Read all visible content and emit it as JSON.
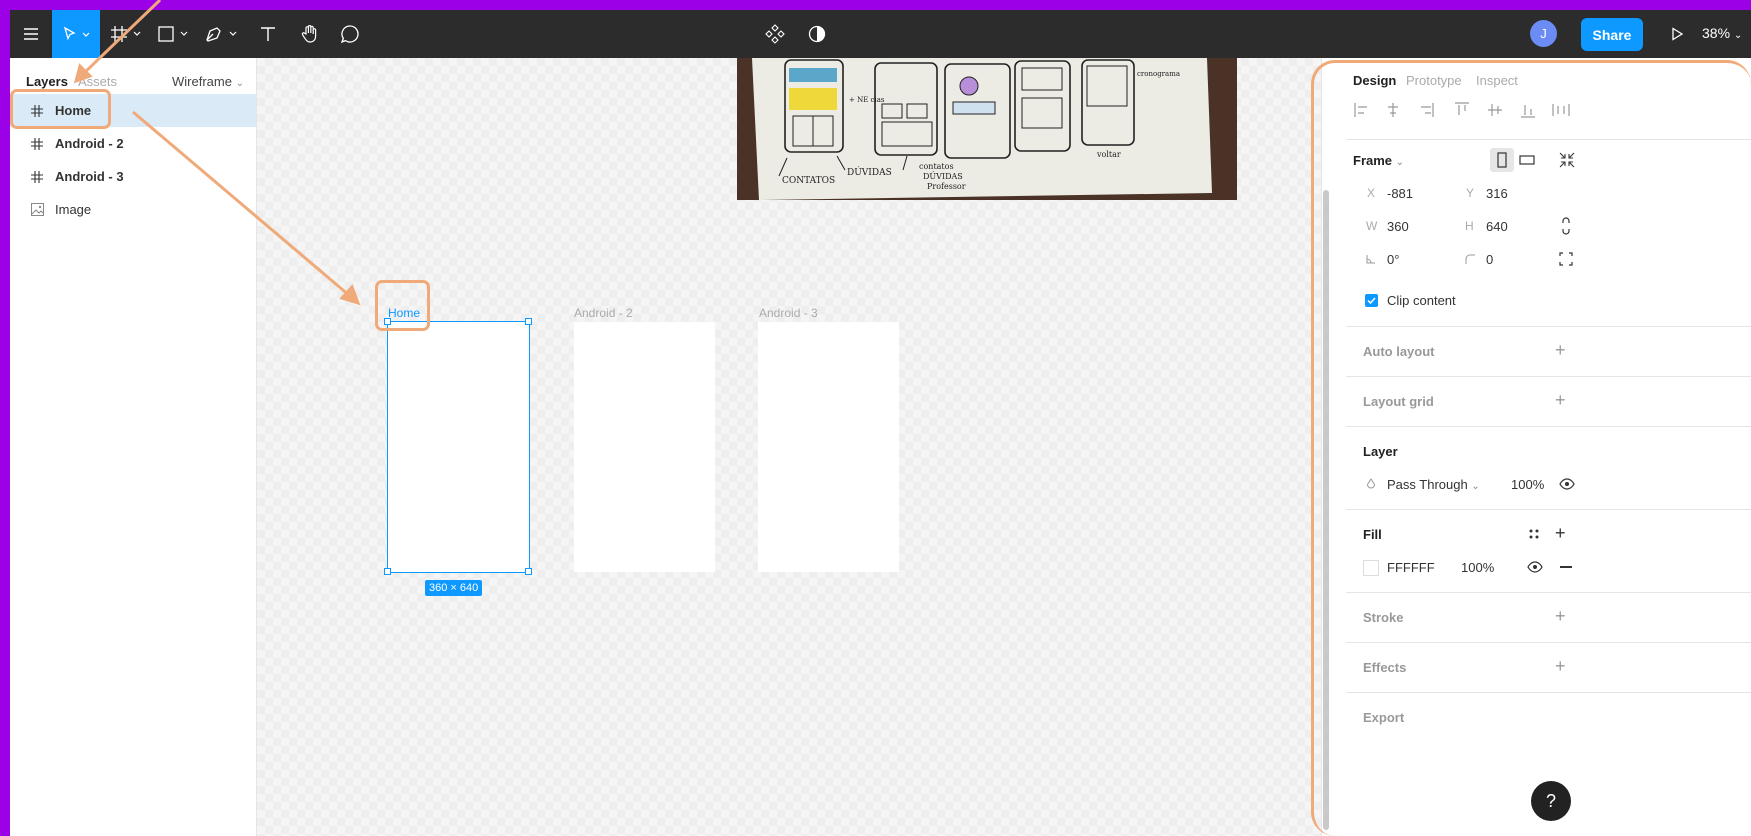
{
  "toolbar": {
    "share_label": "Share",
    "avatar_initial": "J",
    "zoom": "38%"
  },
  "left_panel": {
    "tab_layers": "Layers",
    "tab_assets": "Assets",
    "page_name": "Wireframe",
    "layers": [
      {
        "label": "Home",
        "type": "frame",
        "selected": true
      },
      {
        "label": "Android - 2",
        "type": "frame",
        "selected": false
      },
      {
        "label": "Android - 3",
        "type": "frame",
        "selected": false
      },
      {
        "label": "Image",
        "type": "image",
        "selected": false
      }
    ]
  },
  "canvas": {
    "frames": [
      {
        "label": "Home",
        "selected": true,
        "dims": "360 × 640"
      },
      {
        "label": "Android - 2",
        "selected": false
      },
      {
        "label": "Android - 3",
        "selected": false
      }
    ],
    "sketch_texts": [
      "CONTATOS",
      "DÚVIDAS",
      "contatos",
      "DÚVIDAS",
      "Professor",
      "voltar",
      "+ NE cias",
      "cronograma"
    ]
  },
  "right_panel": {
    "tabs": [
      "Design",
      "Prototype",
      "Inspect"
    ],
    "frame_label": "Frame",
    "x_label": "X",
    "x_value": "-881",
    "y_label": "Y",
    "y_value": "316",
    "w_label": "W",
    "w_value": "360",
    "h_label": "H",
    "h_value": "640",
    "rotation": "0°",
    "radius": "0",
    "clip_content": "Clip content",
    "auto_layout": "Auto layout",
    "layout_grid": "Layout grid",
    "layer_title": "Layer",
    "blend_mode": "Pass Through",
    "opacity": "100%",
    "fill_title": "Fill",
    "fill_hex": "FFFFFF",
    "fill_opacity": "100%",
    "stroke": "Stroke",
    "effects": "Effects",
    "export": "Export",
    "help": "?"
  },
  "colors": {
    "accent": "#0d99ff",
    "annotation": "#f0aa7a",
    "border_frame": "#9b00e6",
    "toolbar_bg": "#2c2c2c"
  }
}
